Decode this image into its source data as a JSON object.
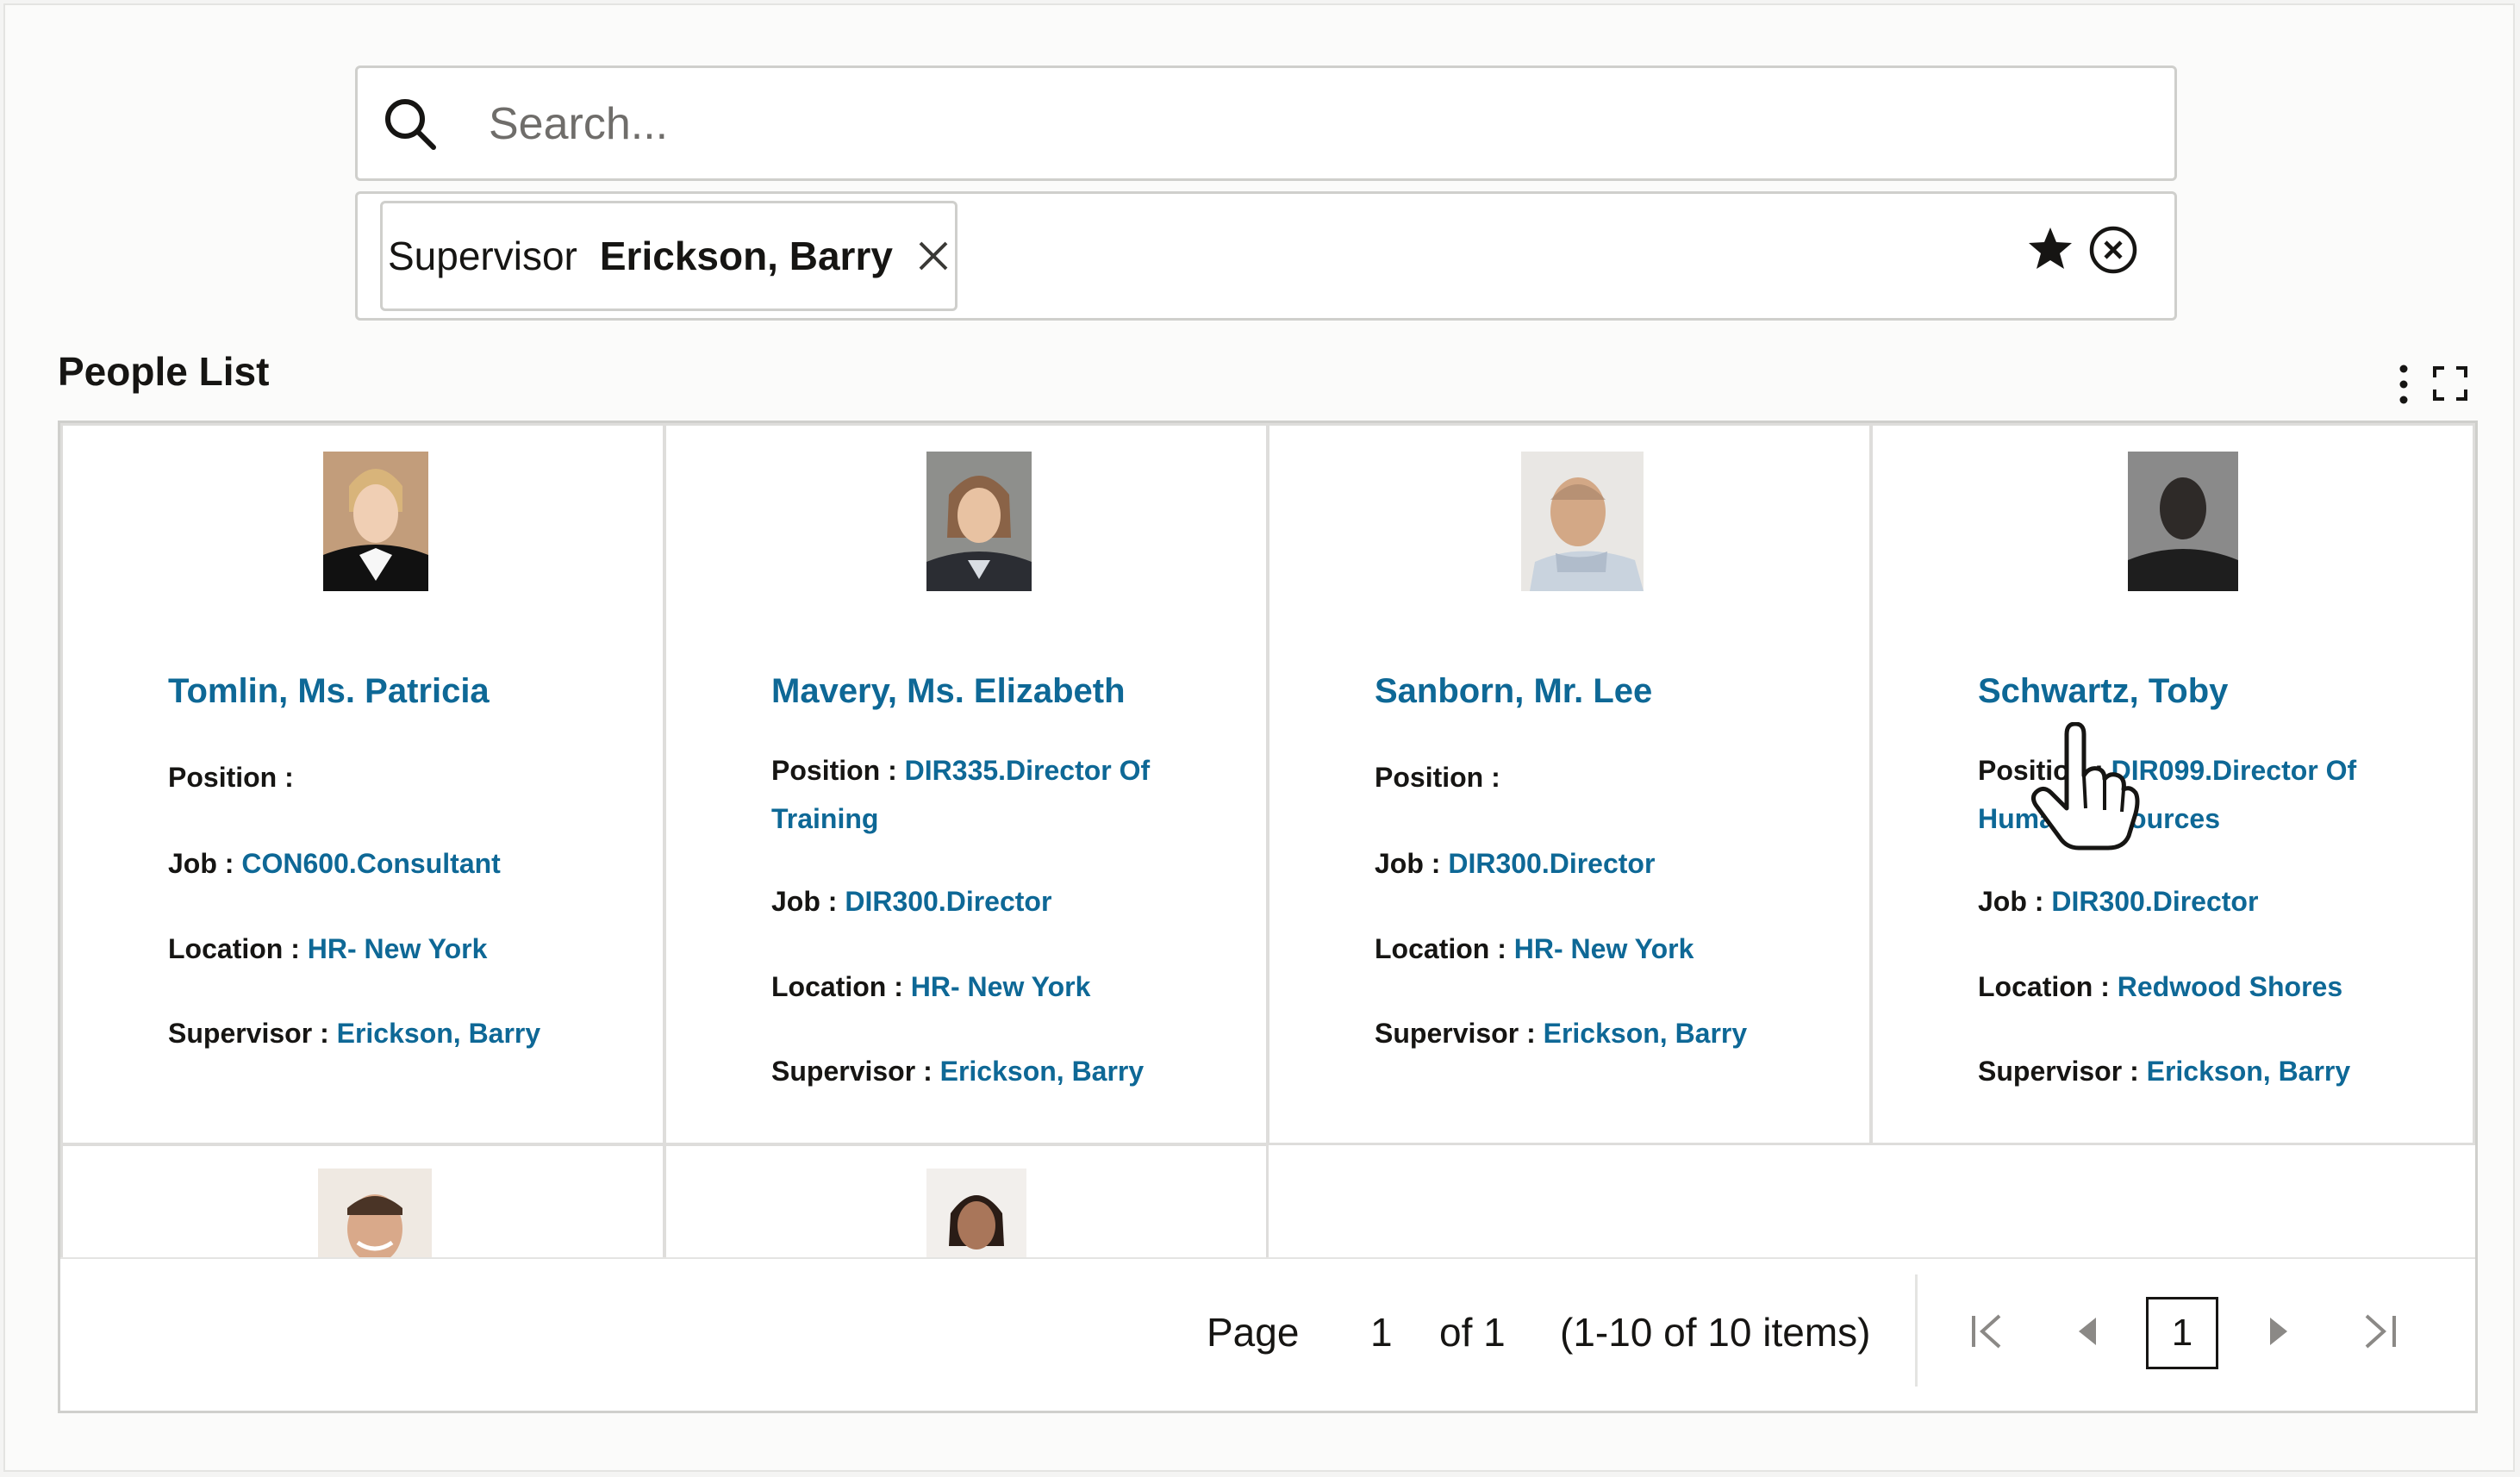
{
  "search": {
    "placeholder": "Search..."
  },
  "filter": {
    "label": "Supervisor",
    "value": "Erickson, Barry"
  },
  "section_title": "People List",
  "people": [
    {
      "name": "Tomlin, Ms. Patricia",
      "position_label": "Position :",
      "position": "",
      "job_label": "Job :",
      "job": "CON600.Consultant",
      "location_label": "Location :",
      "location": "HR- New York",
      "supervisor_label": "Supervisor :",
      "supervisor": "Erickson, Barry"
    },
    {
      "name": "Mavery, Ms. Elizabeth",
      "position_label": "Position :",
      "position": "DIR335.Director Of Training",
      "job_label": "Job :",
      "job": "DIR300.Director",
      "location_label": "Location :",
      "location": "HR- New York",
      "supervisor_label": "Supervisor :",
      "supervisor": "Erickson, Barry"
    },
    {
      "name": "Sanborn, Mr. Lee",
      "position_label": "Position :",
      "position": "",
      "job_label": "Job :",
      "job": "DIR300.Director",
      "location_label": "Location :",
      "location": "HR- New York",
      "supervisor_label": "Supervisor :",
      "supervisor": "Erickson, Barry"
    },
    {
      "name": "Schwartz, Toby",
      "position_label": "Position :",
      "position": "DIR099.Director Of Human Resources",
      "job_label": "Job :",
      "job": "DIR300.Director",
      "location_label": "Location :",
      "location": "Redwood Shores",
      "supervisor_label": "Supervisor :",
      "supervisor": "Erickson, Barry"
    }
  ],
  "pager": {
    "page_label": "Page",
    "page_value": "1",
    "of_label": "of 1",
    "range_label": "(1-10 of 10 items)",
    "current_page": "1"
  },
  "icons": {
    "search": "search-icon",
    "chip_close": "close-icon",
    "favorite": "star-icon",
    "clear": "clear-circle-icon",
    "more": "more-vertical-icon",
    "expand": "expand-icon",
    "first": "first-page-icon",
    "prev": "previous-page-icon",
    "next": "next-page-icon",
    "last": "last-page-icon"
  },
  "colors": {
    "link": "#0e6896",
    "border": "#cfcfcc",
    "text": "#161513"
  }
}
